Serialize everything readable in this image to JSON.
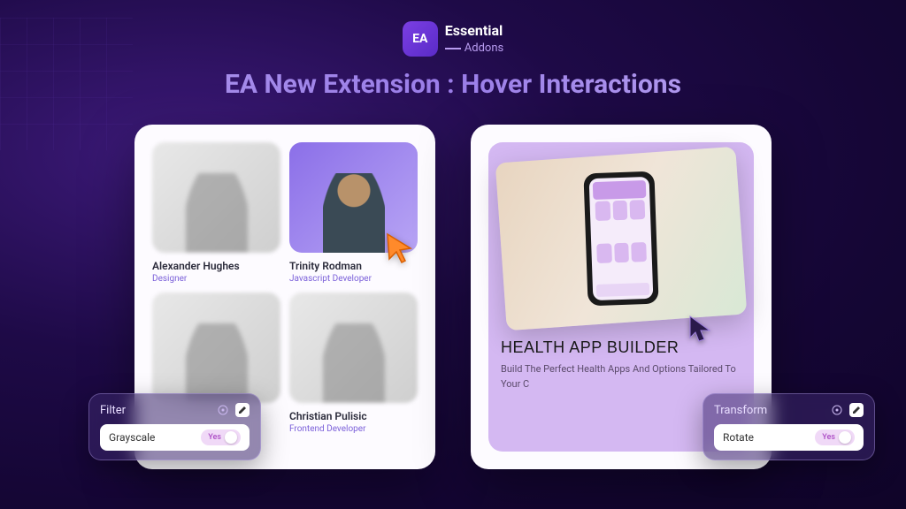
{
  "brand": {
    "icon_text": "EA",
    "name": "Essential",
    "subname": "Addons"
  },
  "headline": "EA New Extension : Hover Interactions",
  "team": [
    {
      "name": "Alexander Hughes",
      "role": "Designer"
    },
    {
      "name": "Trinity Rodman",
      "role": "Javascript Developer"
    },
    {
      "name": "",
      "role": ""
    },
    {
      "name": "Christian Pulisic",
      "role": "Frontend Developer"
    }
  ],
  "promo": {
    "title": "HEALTH APP BUILDER",
    "description": "Build The Perfect Health Apps And Options Tailored To Your C"
  },
  "controls": {
    "filter": {
      "title": "Filter",
      "option": "Grayscale",
      "toggle": "Yes"
    },
    "transform": {
      "title": "Transform",
      "option": "Rotate",
      "toggle": "Yes"
    }
  }
}
